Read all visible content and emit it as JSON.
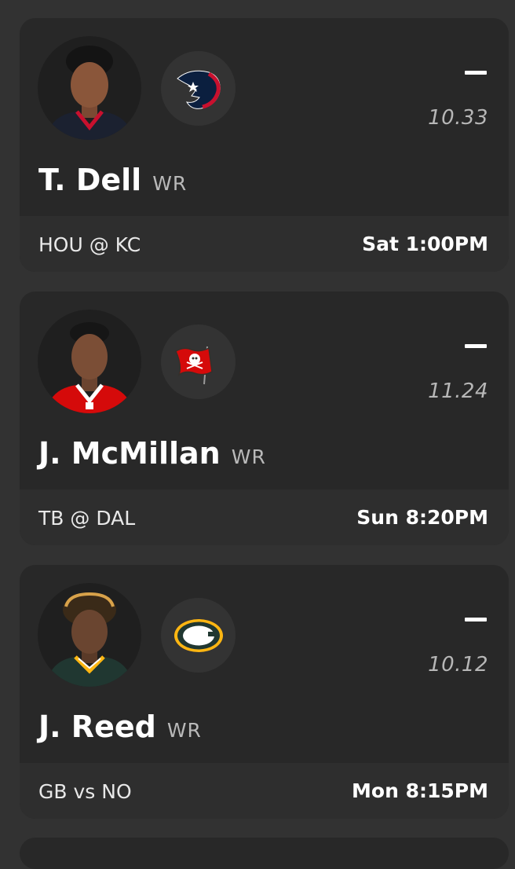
{
  "players": [
    {
      "name": "T. Dell",
      "position": "WR",
      "status_dash": "–",
      "projection": "10.33",
      "matchup": "HOU @ KC",
      "game_time": "Sat 1:00PM",
      "team_logo_icon": "houston-texans-logo-icon",
      "jersey_color": "#1b2130",
      "jersey_trim": "#c8102e"
    },
    {
      "name": "J. McMillan",
      "position": "WR",
      "status_dash": "–",
      "projection": "11.24",
      "matchup": "TB @ DAL",
      "game_time": "Sun 8:20PM",
      "team_logo_icon": "tampa-bay-buccaneers-logo-icon",
      "jersey_color": "#d50a0a",
      "jersey_trim": "#ffffff"
    },
    {
      "name": "J. Reed",
      "position": "WR",
      "status_dash": "–",
      "projection": "10.12",
      "matchup": "GB vs NO",
      "game_time": "Mon 8:15PM",
      "team_logo_icon": "green-bay-packers-logo-icon",
      "jersey_color": "#203731",
      "jersey_trim": "#ffb612"
    }
  ],
  "colors": {
    "background": "#323232",
    "card": "#282828",
    "card_footer": "#2e2e2e",
    "muted_text": "#b7b7b7"
  }
}
